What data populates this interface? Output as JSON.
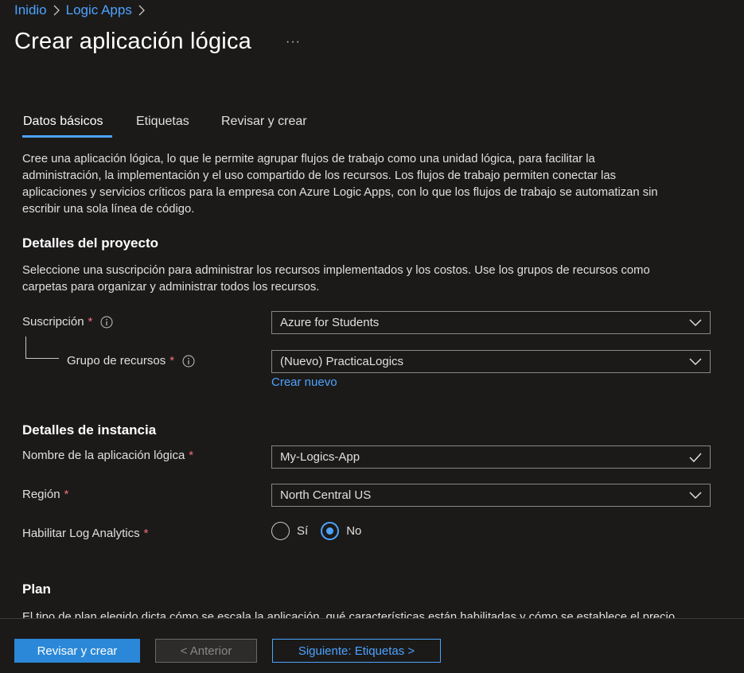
{
  "breadcrumb": {
    "items": [
      "Inidio",
      "Logic Apps"
    ]
  },
  "header": {
    "title": "Crear aplicación lógica",
    "more": "···"
  },
  "tabs": [
    {
      "label": "Datos básicos",
      "active": true
    },
    {
      "label": "Etiquetas",
      "active": false
    },
    {
      "label": "Revisar y crear",
      "active": false
    }
  ],
  "intro": {
    "lines": [
      "Cree una aplicación lógica, lo que le permite agrupar flujos de trabajo como una unidad lógica, para facilitar la",
      "administración, la implementación y el uso compartido de los recursos. Los flujos de trabajo permiten conectar las",
      "aplicaciones y servicios críticos para la empresa con Azure Logic Apps, con lo que los flujos de trabajo se automatizan sin",
      "escribir una sola línea de código."
    ]
  },
  "project": {
    "title": "Detalles del proyecto",
    "description_lines": [
      "Seleccione una suscripción para administrar los recursos implementados y los costos. Use los grupos de recursos como",
      "carpetas para organizar y administrar todos los recursos."
    ],
    "subscription_label": "Suscripción",
    "subscription_value": "Azure for Students",
    "resource_group_label": "Grupo de recursos",
    "resource_group_value": "(Nuevo) PracticaLogics",
    "create_new_link": "Crear nuevo"
  },
  "instance": {
    "title": "Detalles de instancia",
    "name_label": "Nombre de la aplicación lógica",
    "name_value": "My-Logics-App",
    "region_label": "Región",
    "region_value": "North Central US",
    "log_label": "Habilitar Log Analytics",
    "log_options": [
      {
        "label": "Sí",
        "checked": false
      },
      {
        "label": "No",
        "checked": true
      }
    ]
  },
  "plan": {
    "title": "Plan",
    "description_partial": "El tipo de plan elegido dicta cómo se escala la aplicación, qué características están habilitadas y cómo se establece el precio."
  },
  "required_marker": "*",
  "footer": {
    "review_create": "Revisar y crear",
    "previous": "< Anterior",
    "next": "Siguiente: Etiquetas >"
  },
  "colors": {
    "background": "#1b1a19",
    "accent": "#4da3ff",
    "primary_button": "#2b88d8",
    "required": "#f1707b"
  }
}
